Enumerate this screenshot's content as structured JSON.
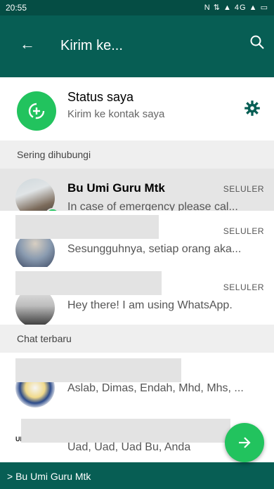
{
  "statusbar": {
    "time": "20:55",
    "indicators": "N ⇅ ▲ 4G ▲ ▭"
  },
  "appbar": {
    "title": "Kirim ke..."
  },
  "my_status": {
    "name": "Status saya",
    "subtitle": "Kirim ke kontak saya"
  },
  "sections": {
    "frequent": "Sering dihubungi",
    "recent": "Chat terbaru"
  },
  "contacts": [
    {
      "name": "Bu Umi Guru Mtk",
      "type": "SELULER",
      "message": "In case of emergency please cal...",
      "selected": true
    },
    {
      "name": "",
      "type": "SELULER",
      "message": "Sesungguhnya, setiap orang aka..."
    },
    {
      "name": "",
      "type": "SELULER",
      "message": "Hey there! I am using WhatsApp."
    }
  ],
  "recent_chats": [
    {
      "name": "",
      "message": "Aslab, Dimas, Endah, Mhd, Mhs, ..."
    },
    {
      "name": "",
      "message": "Uad, Uad, Uad Bu, Anda",
      "avatar_text": "UPNORMAL"
    }
  ],
  "bottombar": {
    "selected_label": "> Bu Umi Guru Mtk"
  },
  "icons": {
    "back": "arrow-left",
    "search": "search",
    "settings": "gear",
    "fab": "arrow-right",
    "selected": "check"
  },
  "colors": {
    "primary_dark": "#054d44",
    "primary": "#075e54",
    "accent": "#22c35e"
  }
}
